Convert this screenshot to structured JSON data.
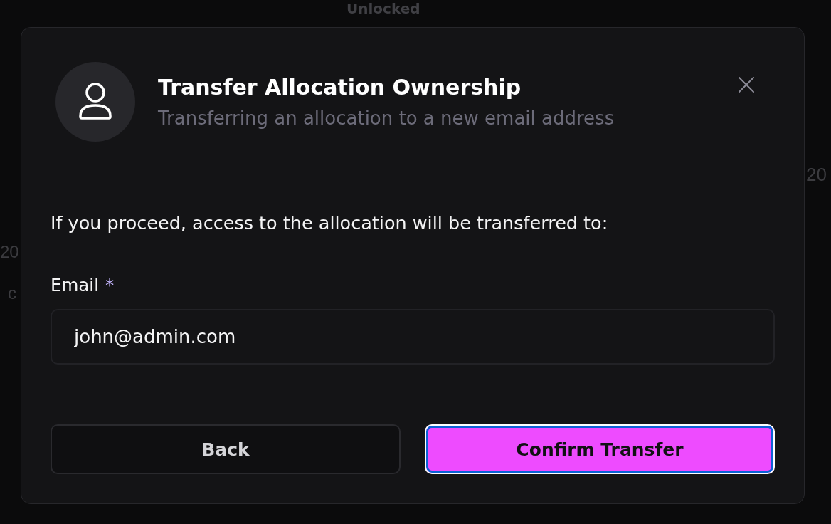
{
  "background": {
    "status": "Unlocked",
    "fragments": [
      "20",
      "c",
      "20"
    ]
  },
  "dialog": {
    "title": "Transfer Allocation Ownership",
    "subtitle": "Transferring an allocation to a new email address",
    "message": "If you proceed, access to the allocation will be transferred to:",
    "field": {
      "label": "Email",
      "required_mark": "*",
      "value": "john@admin.com"
    },
    "buttons": [
      {
        "label": "Back",
        "kind": "secondary",
        "focused": false
      },
      {
        "label": "Confirm Transfer",
        "kind": "primary",
        "focused": true
      }
    ]
  }
}
